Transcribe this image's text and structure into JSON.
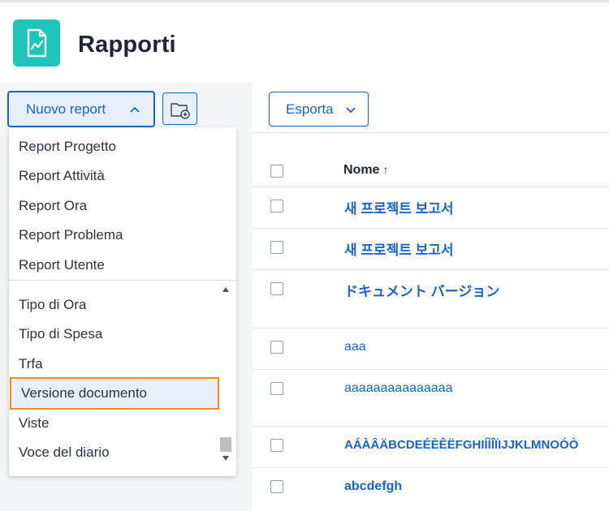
{
  "header": {
    "title": "Rapporti",
    "logo_icon": "report-chart-icon",
    "logo_color": "#1ec5b8"
  },
  "toolbar_left": {
    "new_report_label": "Nuovo report",
    "new_folder_icon": "folder-add-icon"
  },
  "dropdown": {
    "top_items": [
      "Report Progetto",
      "Report Attività",
      "Report Ora",
      "Report Problema",
      "Report Utente"
    ],
    "bottom_items": [
      "Tipo di Ora",
      "Tipo di Spesa",
      "Trfa",
      "Versione documento",
      "Viste",
      "Voce del diario"
    ],
    "selected": "Versione documento"
  },
  "toolbar_right": {
    "export_label": "Esporta"
  },
  "table": {
    "column_name": "Nome",
    "sort_indicator": "↑",
    "rows": [
      "새 프로젝트 보고서",
      "새 프로젝트 보고서",
      "ドキュメント バージョン",
      "aaa",
      "aaaaaaaaaaaaaaa",
      "AÁÀÂÄBCDEÉÈÊËFGHIÍÌÎÏIJJKLMNOÓÒ",
      "abcdefgh"
    ]
  },
  "colors": {
    "accent": "#1a65c4",
    "selection_border": "#f28c1b",
    "selection_bg": "#e6f0fb"
  }
}
